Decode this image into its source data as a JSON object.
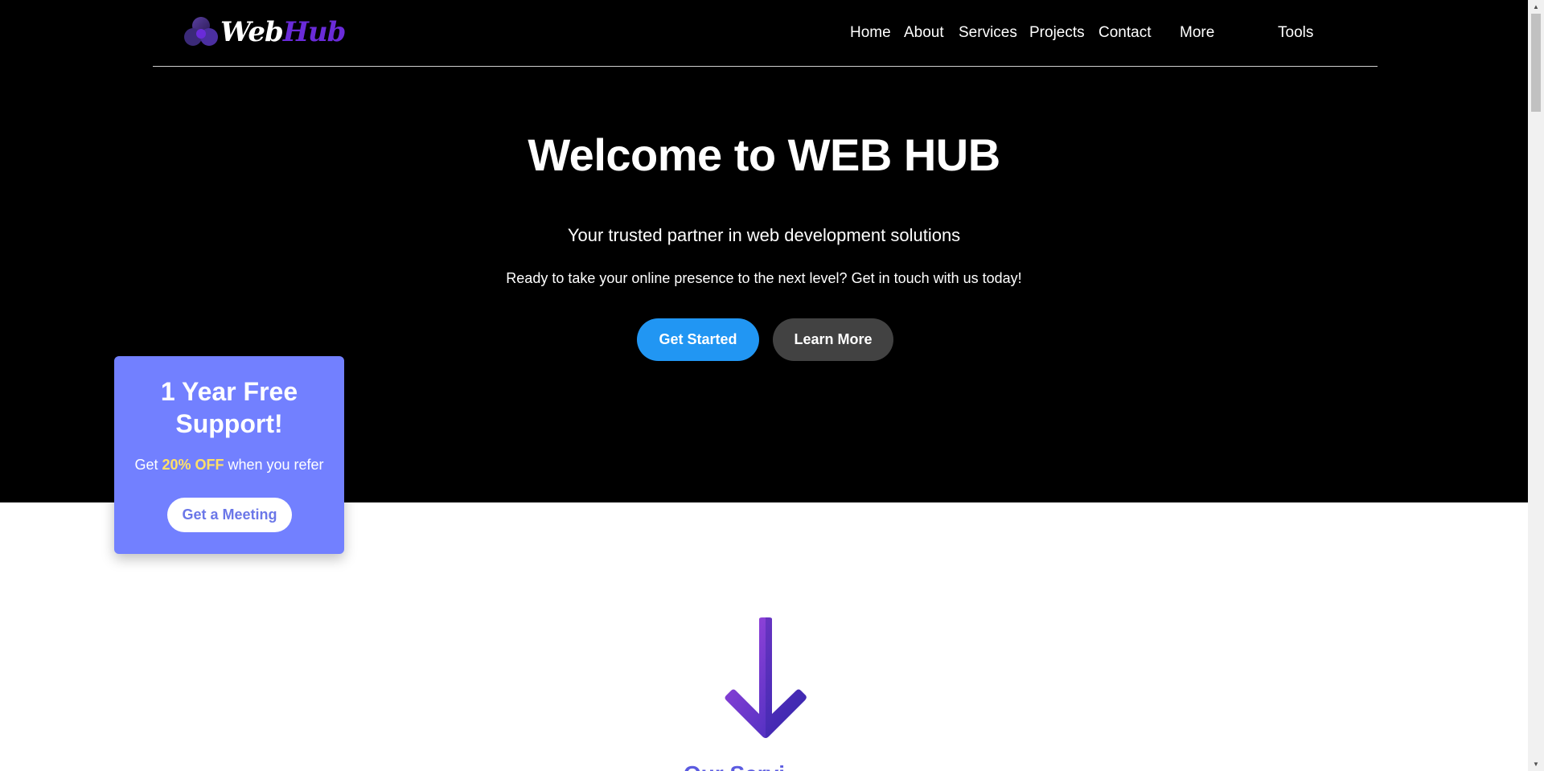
{
  "nav": {
    "logo": {
      "part1": "Web",
      "part2": "Hub",
      "icon": "triple-blob-logo-icon"
    },
    "links": [
      "Home",
      "About",
      "Services",
      "Projects",
      "Contact",
      "More",
      "Tools"
    ]
  },
  "hero": {
    "title": "Welcome to WEB HUB",
    "subtitle": "Your trusted partner in web development solutions",
    "tagline": "Ready to take your online presence to the next level? Get in touch with us today!",
    "primary_button": "Get Started",
    "secondary_button": "Learn More"
  },
  "promo": {
    "title": "1 Year Free Support!",
    "text_before": "Get ",
    "highlight": "20% OFF",
    "text_after": " when you refer",
    "button": "Get a Meeting"
  },
  "section": {
    "arrow_icon": "arrow-down-icon",
    "heading_partial": "Our Servi..."
  },
  "scrollbar": {
    "up_icon": "scroll-up-icon",
    "down_icon": "scroll-down-icon"
  },
  "colors": {
    "hero_bg": "#000000",
    "brand_purple": "#6a2bd9",
    "primary_blue": "#2196f3",
    "secondary_gray": "#424242",
    "promo_bg": "#7280ff",
    "promo_highlight": "#ffe066"
  }
}
